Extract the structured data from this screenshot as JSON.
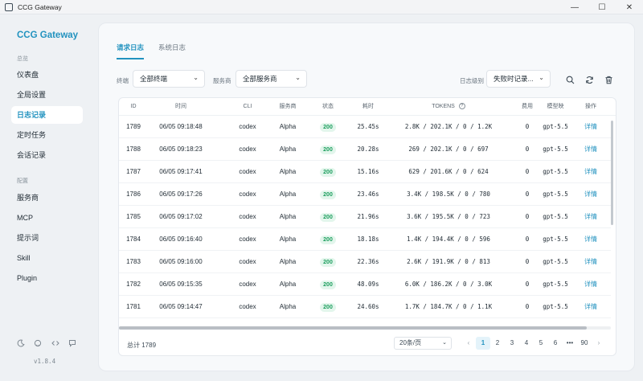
{
  "window": {
    "title": "CCG Gateway",
    "minimize": "—",
    "maximize": "☐",
    "close": "✕"
  },
  "sidebar": {
    "brand": "CCG Gateway",
    "section_overview": "总览",
    "overview_items": [
      {
        "label": "仪表盘"
      },
      {
        "label": "全局设置"
      },
      {
        "label": "日志记录"
      },
      {
        "label": "定时任务"
      },
      {
        "label": "会话记录"
      }
    ],
    "section_config": "配置",
    "config_items": [
      {
        "label": "服务商"
      },
      {
        "label": "MCP"
      },
      {
        "label": "提示词"
      },
      {
        "label": "Skill"
      },
      {
        "label": "Plugin"
      }
    ],
    "footer_icons": [
      "moon-icon",
      "github-icon",
      "code-icon",
      "chat-icon"
    ],
    "version": "v1.8.4"
  },
  "tabs": [
    {
      "label": "请求日志"
    },
    {
      "label": "系统日志"
    }
  ],
  "filters": {
    "terminal_label": "终端",
    "terminal_value": "全部终端",
    "provider_label": "服务商",
    "provider_value": "全部服务商",
    "level_label": "日志级别",
    "level_value": "失败时记录..."
  },
  "table": {
    "columns": [
      "ID",
      "时间",
      "CLI",
      "服务商",
      "状态",
      "耗时",
      "TOKENS",
      "费用",
      "模型映",
      "操作"
    ],
    "rows": [
      {
        "id": "1789",
        "time": "06/05 09:18:48",
        "cli": "codex",
        "provider": "Alpha",
        "status": "200",
        "duration": "25.45s",
        "tokens": "2.8K / 202.1K / 0 / 1.2K",
        "cost": "0",
        "model": "gpt-5.5",
        "action": "详情"
      },
      {
        "id": "1788",
        "time": "06/05 09:18:23",
        "cli": "codex",
        "provider": "Alpha",
        "status": "200",
        "duration": "20.28s",
        "tokens": "269 / 202.1K / 0 / 697",
        "cost": "0",
        "model": "gpt-5.5",
        "action": "详情"
      },
      {
        "id": "1787",
        "time": "06/05 09:17:41",
        "cli": "codex",
        "provider": "Alpha",
        "status": "200",
        "duration": "15.16s",
        "tokens": "629 / 201.6K / 0 / 624",
        "cost": "0",
        "model": "gpt-5.5",
        "action": "详情"
      },
      {
        "id": "1786",
        "time": "06/05 09:17:26",
        "cli": "codex",
        "provider": "Alpha",
        "status": "200",
        "duration": "23.46s",
        "tokens": "3.4K / 198.5K / 0 / 780",
        "cost": "0",
        "model": "gpt-5.5",
        "action": "详情"
      },
      {
        "id": "1785",
        "time": "06/05 09:17:02",
        "cli": "codex",
        "provider": "Alpha",
        "status": "200",
        "duration": "21.96s",
        "tokens": "3.6K / 195.5K / 0 / 723",
        "cost": "0",
        "model": "gpt-5.5",
        "action": "详情"
      },
      {
        "id": "1784",
        "time": "06/05 09:16:40",
        "cli": "codex",
        "provider": "Alpha",
        "status": "200",
        "duration": "18.18s",
        "tokens": "1.4K / 194.4K / 0 / 596",
        "cost": "0",
        "model": "gpt-5.5",
        "action": "详情"
      },
      {
        "id": "1783",
        "time": "06/05 09:16:00",
        "cli": "codex",
        "provider": "Alpha",
        "status": "200",
        "duration": "22.36s",
        "tokens": "2.6K / 191.9K / 0 / 813",
        "cost": "0",
        "model": "gpt-5.5",
        "action": "详情"
      },
      {
        "id": "1782",
        "time": "06/05 09:15:35",
        "cli": "codex",
        "provider": "Alpha",
        "status": "200",
        "duration": "48.09s",
        "tokens": "6.0K / 186.2K / 0 / 3.0K",
        "cost": "0",
        "model": "gpt-5.5",
        "action": "详情"
      },
      {
        "id": "1781",
        "time": "06/05 09:14:47",
        "cli": "codex",
        "provider": "Alpha",
        "status": "200",
        "duration": "24.60s",
        "tokens": "1.7K / 184.7K / 0 / 1.1K",
        "cost": "0",
        "model": "gpt-5.5",
        "action": "详情"
      }
    ]
  },
  "footer": {
    "total": "总计 1789",
    "page_size": "20条/页",
    "pages": [
      "1",
      "2",
      "3",
      "4",
      "5",
      "6",
      "•••",
      "90"
    ],
    "prev": "‹",
    "next": "›"
  },
  "colors": {
    "accent": "#2192bf",
    "success_bg": "#e3f6ec",
    "success_text": "#1a9d5c"
  }
}
